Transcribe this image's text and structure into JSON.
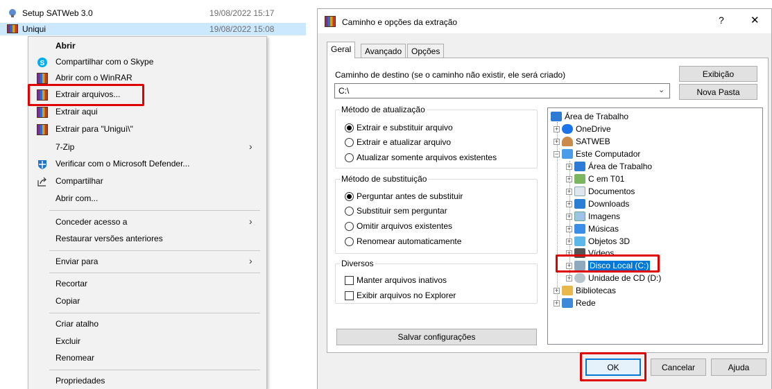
{
  "explorer": {
    "rows": [
      {
        "name": "Setup SATWeb 3.0",
        "date": "19/08/2022 15:17"
      },
      {
        "name": "Uniqui",
        "date": "19/08/2022 15:08"
      }
    ]
  },
  "context_menu": {
    "items": [
      {
        "label": "Abrir",
        "icon": "none"
      },
      {
        "label": "Compartilhar com o Skype",
        "icon": "skype-icon"
      },
      {
        "label": "Abrir com o WinRAR",
        "icon": "winrar-icon"
      },
      {
        "label": "Extrair arquivos...",
        "icon": "winrar-icon"
      },
      {
        "label": "Extrair aqui",
        "icon": "winrar-icon"
      },
      {
        "label": "Extrair para \"Uniguì\\\"",
        "icon": "winrar-icon"
      },
      {
        "label": "7-Zip",
        "icon": "none"
      },
      {
        "label": "Verificar com o Microsoft Defender...",
        "icon": "defender-icon"
      },
      {
        "label": "Compartilhar",
        "icon": "share-icon"
      },
      {
        "label": "Abrir com...",
        "icon": "none"
      },
      {
        "label": "Conceder acesso a",
        "icon": "none"
      },
      {
        "label": "Restaurar versões anteriores",
        "icon": "none"
      },
      {
        "label": "Enviar para",
        "icon": "none"
      },
      {
        "label": "Recortar",
        "icon": "none"
      },
      {
        "label": "Copiar",
        "icon": "none"
      },
      {
        "label": "Criar atalho",
        "icon": "none"
      },
      {
        "label": "Excluir",
        "icon": "none"
      },
      {
        "label": "Renomear",
        "icon": "none"
      },
      {
        "label": "Propriedades",
        "icon": "none"
      }
    ],
    "submenu_arrow": "›"
  },
  "dialog": {
    "title": "Caminho e opções da extração",
    "help_glyph": "?",
    "close_glyph": "✕",
    "tabs": [
      "Geral",
      "Avançado",
      "Opções"
    ],
    "dest_label": "Caminho de destino (se o caminho não existir, ele será criado)",
    "dest_value": "C:\\",
    "exibicao_button": "Exibição",
    "nova_pasta_button": "Nova Pasta",
    "update_group": {
      "label": "Método de atualização",
      "options": [
        "Extrair e substituir arquivo",
        "Extrair e atualizar arquivo",
        "Atualizar somente arquivos existentes"
      ],
      "selected_index": 0
    },
    "overwrite_group": {
      "label": "Método de substituição",
      "options": [
        "Perguntar antes de substituir",
        "Substituir sem perguntar",
        "Omitir arquivos existentes",
        "Renomear automaticamente"
      ],
      "selected_index": 0
    },
    "misc_group": {
      "label": "Diversos",
      "options": [
        "Manter arquivos inativos",
        "Exibir arquivos no Explorer"
      ]
    },
    "save_settings_button": "Salvar configurações",
    "tree": [
      {
        "label": "Área de Trabalho",
        "icon": "desktop-icon"
      },
      {
        "label": "OneDrive",
        "icon": "onedrive-icon"
      },
      {
        "label": "SATWEB",
        "icon": "user-icon"
      },
      {
        "label": "Este Computador",
        "icon": "computer-icon"
      },
      {
        "label": "Área de Trabalho",
        "icon": "desktop-icon"
      },
      {
        "label": "C em T01",
        "icon": "network-drive-icon"
      },
      {
        "label": "Documentos",
        "icon": "documents-icon"
      },
      {
        "label": "Downloads",
        "icon": "downloads-icon"
      },
      {
        "label": "Imagens",
        "icon": "images-icon"
      },
      {
        "label": "Músicas",
        "icon": "music-icon"
      },
      {
        "label": "Objetos 3D",
        "icon": "objects3d-icon"
      },
      {
        "label": "Vídeos",
        "icon": "videos-icon"
      },
      {
        "label": "Disco Local (C:)",
        "icon": "local-disk-icon"
      },
      {
        "label": "Unidade de CD (D:)",
        "icon": "cd-drive-icon"
      },
      {
        "label": "Bibliotecas",
        "icon": "libraries-icon"
      },
      {
        "label": "Rede",
        "icon": "network-icon"
      }
    ],
    "ok_button": "OK",
    "cancel_button": "Cancelar",
    "help_button": "Ajuda"
  },
  "colors": {
    "highlight_red": "#e00000",
    "selection_blue": "#0078d7",
    "row_selected": "#cce8ff"
  }
}
